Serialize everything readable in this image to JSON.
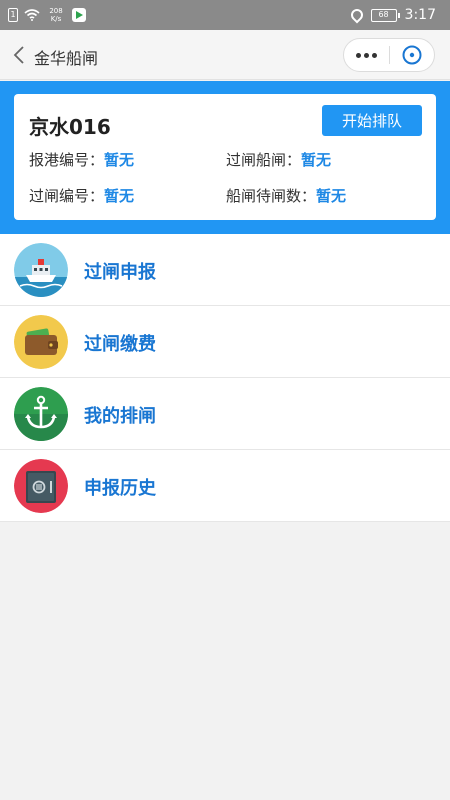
{
  "status_bar": {
    "sim": "1",
    "net_speed": "208\nK/s",
    "battery": "68",
    "time": "3:17"
  },
  "nav": {
    "title": "金华船闸"
  },
  "ship_card": {
    "name": "京水016",
    "button_label": "开始排队",
    "fields": [
      {
        "label": "报港编号：",
        "value": "暂无"
      },
      {
        "label": "过闸船闸：",
        "value": "暂无"
      },
      {
        "label": "过闸编号：",
        "value": "暂无"
      },
      {
        "label": "船闸待闸数：",
        "value": "暂无"
      }
    ]
  },
  "menu": {
    "items": [
      {
        "label": "过闸申报",
        "icon": "ship-icon"
      },
      {
        "label": "过闸缴费",
        "icon": "wallet-icon"
      },
      {
        "label": "我的排闸",
        "icon": "anchor-icon"
      },
      {
        "label": "申报历史",
        "icon": "safe-icon"
      }
    ]
  },
  "colors": {
    "accent": "#2196f3",
    "value_text": "#1e88e5",
    "menu_text": "#1976d2"
  }
}
